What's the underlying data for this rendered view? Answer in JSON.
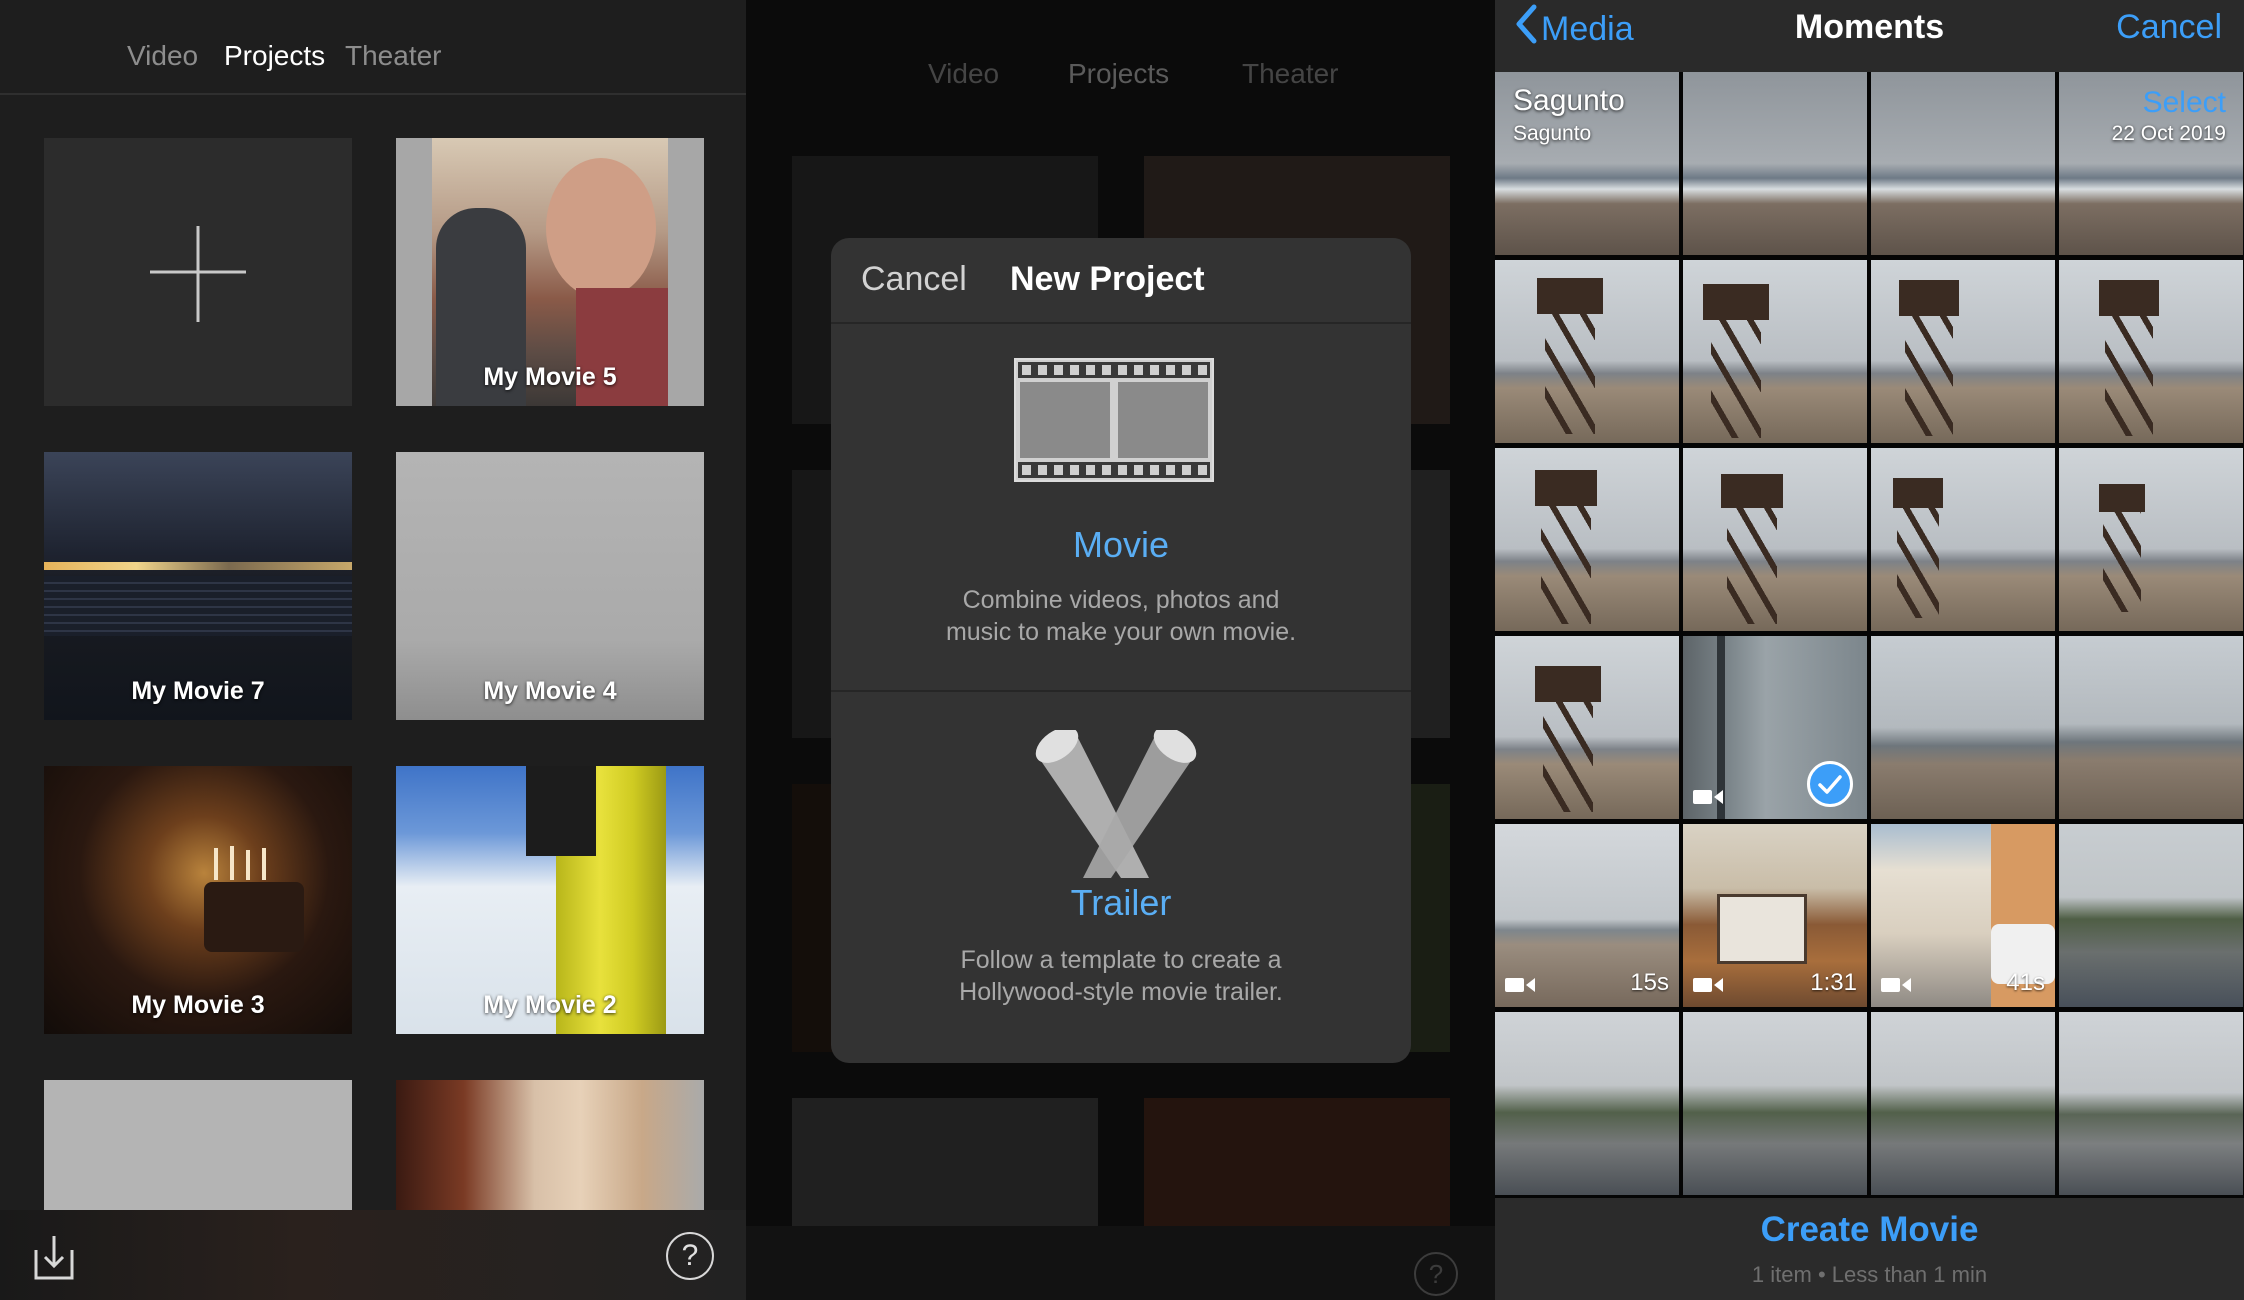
{
  "projects_panel": {
    "tabs": [
      "Video",
      "Projects",
      "Theater"
    ],
    "active_tab": "Projects",
    "projects": [
      "My Movie 5",
      "My Movie 7",
      "My Movie 4",
      "My Movie 3",
      "My Movie 2"
    ],
    "help_label": "?"
  },
  "new_project_panel": {
    "dimmed_tabs": [
      "Video",
      "Projects",
      "Theater"
    ],
    "dialog": {
      "cancel_label": "Cancel",
      "title": "New Project",
      "movie": {
        "title": "Movie",
        "description_line1": "Combine videos, photos and",
        "description_line2": "music to make your own movie."
      },
      "trailer": {
        "title": "Trailer",
        "description_line1": "Follow a template to create a",
        "description_line2": "Hollywood-style movie trailer."
      }
    }
  },
  "moments_panel": {
    "nav": {
      "back_label": "Media",
      "title": "Moments",
      "cancel_label": "Cancel"
    },
    "section": {
      "place": "Sagunto",
      "subplace": "Sagunto",
      "select_label": "Select",
      "date": "22 Oct 2019"
    },
    "durations": [
      "15s",
      "1:31",
      "41s"
    ],
    "footer": {
      "create_label": "Create Movie",
      "info": "1 item • Less than 1 min"
    }
  },
  "colors": {
    "accent_blue": "#3c9ef8",
    "trailer_blue": "#5aaef4"
  },
  "icons": [
    "plus-icon",
    "import-icon",
    "help-icon",
    "film-strip-icon",
    "spotlights-icon",
    "back-chevron-icon",
    "video-camera-icon",
    "checkmark-icon"
  ]
}
